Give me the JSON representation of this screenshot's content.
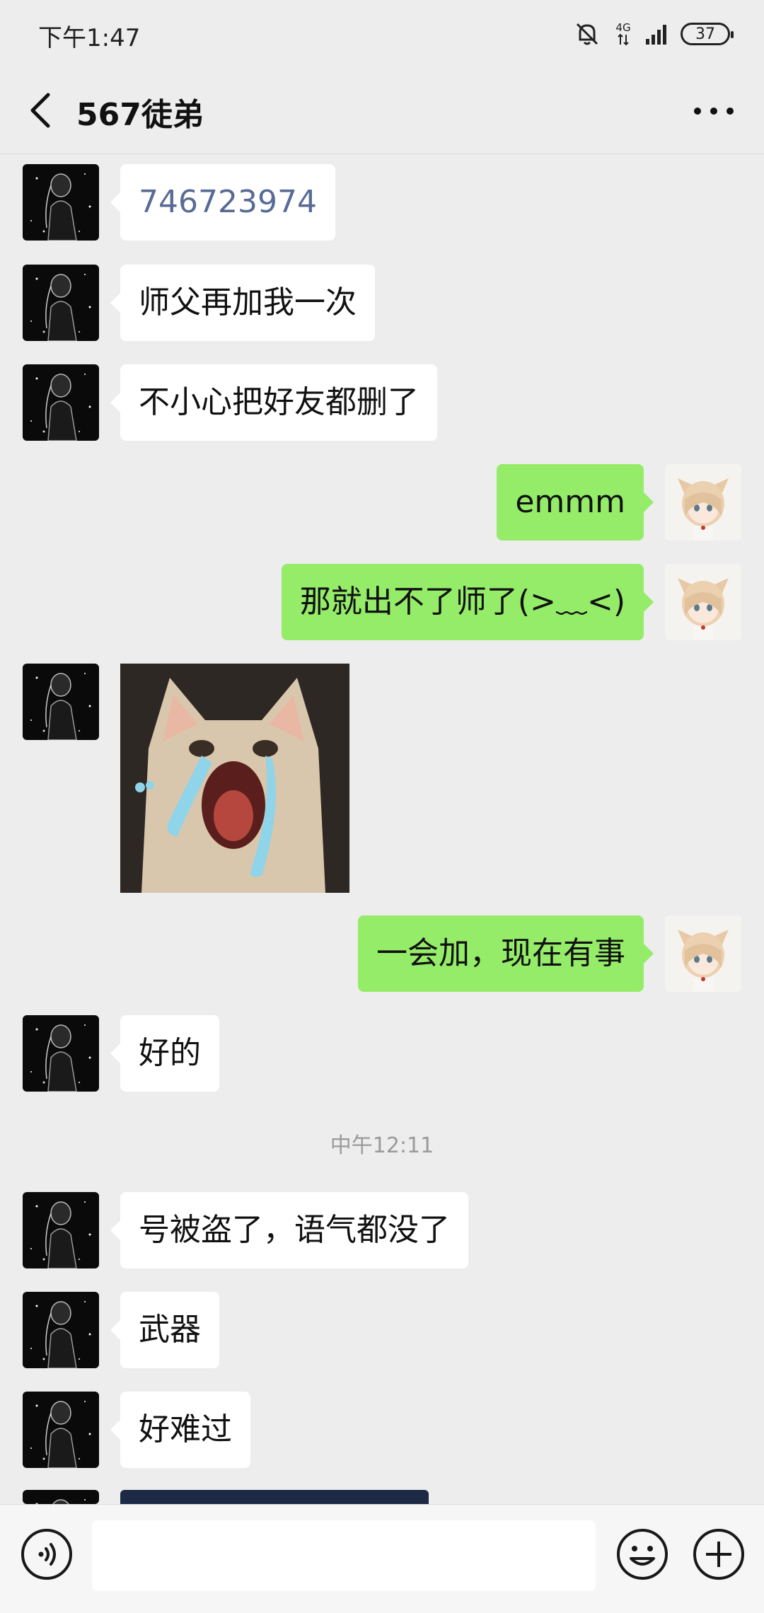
{
  "status_bar": {
    "time": "下午1:47",
    "network": "4G",
    "battery": "37"
  },
  "header": {
    "title": "567徒弟"
  },
  "messages": [
    {
      "side": "left",
      "text": "746723974",
      "link": true
    },
    {
      "side": "left",
      "text": "师父再加我一次"
    },
    {
      "side": "left",
      "text": "不小心把好友都删了"
    },
    {
      "side": "right",
      "text": "emmm"
    },
    {
      "side": "right",
      "text": "那就出不了师了(>﹏<)"
    },
    {
      "side": "left",
      "type": "sticker",
      "icon": "crying-cat-sticker"
    },
    {
      "side": "right",
      "text": "一会加，现在有事"
    },
    {
      "side": "left",
      "text": "好的"
    },
    {
      "type": "timestamp",
      "text": "中午12:11"
    },
    {
      "side": "left",
      "text": "号被盗了，语气都没了"
    },
    {
      "side": "left",
      "text": "武器"
    },
    {
      "side": "left",
      "text": "好难过"
    },
    {
      "side": "left",
      "type": "image",
      "icon": "game-screenshot-partial"
    }
  ],
  "input_bar": {
    "placeholder": "",
    "value": ""
  },
  "colors": {
    "background": "#ededed",
    "self_bubble": "#95ec69",
    "other_bubble": "#ffffff",
    "link": "#576b95"
  }
}
